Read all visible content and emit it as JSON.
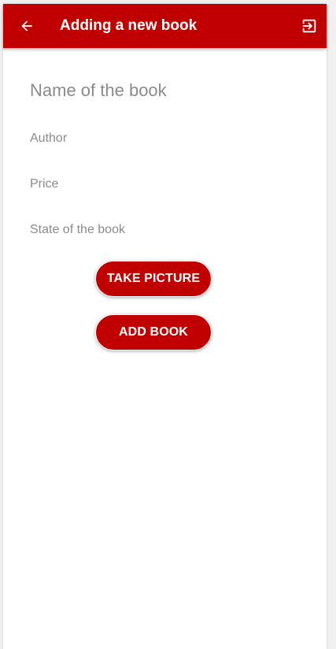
{
  "app_bar": {
    "title": "Adding a new book",
    "back_icon": "arrow-left-icon",
    "logout_icon": "exit-to-app-icon",
    "color": "#c00000"
  },
  "form": {
    "name_placeholder": "Name of the book",
    "author_placeholder": "Author",
    "price_placeholder": "Price",
    "state_placeholder": "State of the book",
    "name_value": "",
    "author_value": "",
    "price_value": "",
    "state_value": ""
  },
  "buttons": {
    "take_picture_label": "TAKE PICTURE",
    "add_book_label": "ADD BOOK",
    "color": "#c00000"
  }
}
